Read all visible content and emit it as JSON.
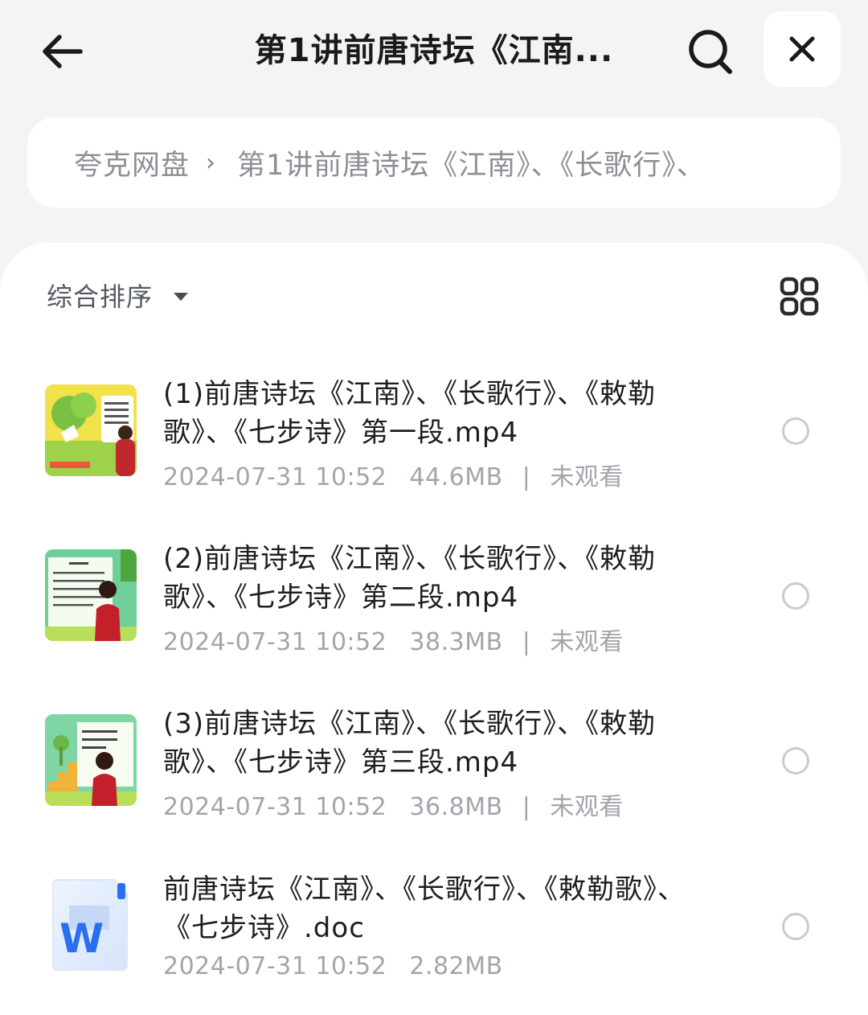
{
  "header": {
    "title": "第1讲前唐诗坛《江南..."
  },
  "breadcrumb": {
    "root": "夸克网盘",
    "separator": "›",
    "current": "第1讲前唐诗坛《江南》、《长歌行》、"
  },
  "toolbar": {
    "sort_label": "综合排序"
  },
  "files": [
    {
      "name": "(1)前唐诗坛《江南》、《长歌行》、《敕勒歌》、《七步诗》第一段.mp4",
      "date": "2024-07-31 10:52",
      "size": "44.6MB",
      "divider": "|",
      "status": "未观看",
      "thumb_type": "video",
      "thumb_variant": "cartoon-tree"
    },
    {
      "name": "(2)前唐诗坛《江南》、《长歌行》、《敕勒歌》、《七步诗》第二段.mp4",
      "date": "2024-07-31 10:52",
      "size": "38.3MB",
      "divider": "|",
      "status": "未观看",
      "thumb_type": "video",
      "thumb_variant": "board-text"
    },
    {
      "name": "(3)前唐诗坛《江南》、《长歌行》、《敕勒歌》、《七步诗》第三段.mp4",
      "date": "2024-07-31 10:52",
      "size": "36.8MB",
      "divider": "|",
      "status": "未观看",
      "thumb_type": "video",
      "thumb_variant": "stairs"
    },
    {
      "name": "前唐诗坛《江南》、《长歌行》、《敕勒歌》、《七步诗》.doc",
      "date": "2024-07-31 10:52",
      "size": "2.82MB",
      "thumb_type": "doc",
      "thumb_letter": "W"
    }
  ],
  "colors": {
    "word_blue": "#2a6ff0",
    "radio_border": "#c9cbcf",
    "meta_text": "#a2a5ab"
  }
}
